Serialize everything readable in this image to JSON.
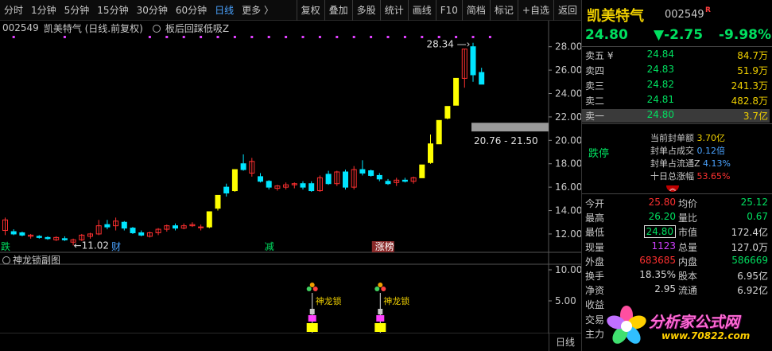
{
  "toolbar": {
    "items": [
      "分时",
      "1分钟",
      "5分钟",
      "15分钟",
      "30分钟",
      "60分钟",
      "日线",
      "更多 〉",
      "复权",
      "叠加",
      "多股",
      "统计",
      "画线",
      "F10",
      "简档",
      "标记",
      "+自选",
      "返回"
    ],
    "active": "日线"
  },
  "chart_header": {
    "code": "002549",
    "name": "凯美特气 (日线.前复权)",
    "indicator": "板后回踩低吸Z"
  },
  "sub_chart": {
    "title": "神龙锁副图",
    "label": "神龙锁",
    "ticks": [
      "10.00",
      "5.00"
    ]
  },
  "chart_data": {
    "type": "candlestick",
    "title": "",
    "xlabel": "",
    "ylabel": "",
    "ylim": [
      10.5,
      29.0
    ],
    "y_ticks": [
      12.0,
      14.0,
      16.0,
      18.0,
      20.0,
      22.0,
      24.0,
      26.0,
      28.0
    ],
    "annotations": {
      "high_label": "28.34",
      "low_label": "11.02",
      "range_label": "20.76 - 21.50",
      "range_band": [
        20.76,
        21.5
      ]
    },
    "event_tags": [
      {
        "text": "跌",
        "index": 0,
        "color": "#00e060"
      },
      {
        "text": "财",
        "index": 13,
        "color": "#4aa3ff"
      },
      {
        "text": "减",
        "index": 31,
        "color": "#00e060"
      },
      {
        "text": "涨榜",
        "index": 44,
        "color": "#ffffff"
      }
    ],
    "x_labels": [
      {
        "text": "2025年",
        "index": 0
      },
      {
        "text": "8",
        "index": 16
      },
      {
        "text": "9",
        "index": 32
      }
    ],
    "candles": [
      {
        "o": 12.3,
        "h": 13.4,
        "l": 11.9,
        "c": 13.2
      },
      {
        "o": 12.2,
        "h": 12.4,
        "l": 11.9,
        "c": 12.0
      },
      {
        "o": 12.1,
        "h": 12.2,
        "l": 11.8,
        "c": 11.9
      },
      {
        "o": 11.8,
        "h": 12.0,
        "l": 11.6,
        "c": 11.9
      },
      {
        "o": 11.8,
        "h": 11.9,
        "l": 11.6,
        "c": 11.7
      },
      {
        "o": 11.7,
        "h": 11.8,
        "l": 11.5,
        "c": 11.6
      },
      {
        "o": 11.5,
        "h": 11.8,
        "l": 11.4,
        "c": 11.7
      },
      {
        "o": 11.6,
        "h": 11.8,
        "l": 11.4,
        "c": 11.5
      },
      {
        "o": 11.3,
        "h": 11.6,
        "l": 11.02,
        "c": 11.5
      },
      {
        "o": 11.5,
        "h": 12.0,
        "l": 11.4,
        "c": 11.9
      },
      {
        "o": 11.8,
        "h": 12.1,
        "l": 11.6,
        "c": 12.0
      },
      {
        "o": 12.0,
        "h": 13.2,
        "l": 11.9,
        "c": 12.7
      },
      {
        "o": 12.8,
        "h": 13.2,
        "l": 12.4,
        "c": 12.6
      },
      {
        "o": 12.7,
        "h": 13.4,
        "l": 12.3,
        "c": 13.1
      },
      {
        "o": 13.0,
        "h": 13.1,
        "l": 12.3,
        "c": 12.5
      },
      {
        "o": 12.5,
        "h": 12.6,
        "l": 12.0,
        "c": 12.1
      },
      {
        "o": 12.1,
        "h": 12.3,
        "l": 11.8,
        "c": 11.9
      },
      {
        "o": 11.8,
        "h": 12.2,
        "l": 11.7,
        "c": 12.1
      },
      {
        "o": 12.1,
        "h": 12.5,
        "l": 11.9,
        "c": 12.4
      },
      {
        "o": 12.4,
        "h": 12.8,
        "l": 12.2,
        "c": 12.7
      },
      {
        "o": 12.7,
        "h": 12.9,
        "l": 12.3,
        "c": 12.5
      },
      {
        "o": 12.5,
        "h": 12.9,
        "l": 12.4,
        "c": 12.7
      },
      {
        "o": 12.7,
        "h": 13.0,
        "l": 12.6,
        "c": 12.8
      },
      {
        "o": 12.6,
        "h": 12.8,
        "l": 12.3,
        "c": 12.6
      },
      {
        "o": 12.6,
        "h": 13.9,
        "l": 12.5,
        "c": 13.9
      },
      {
        "o": 14.2,
        "h": 15.3,
        "l": 14.0,
        "c": 15.3
      },
      {
        "o": 16.0,
        "h": 16.3,
        "l": 15.2,
        "c": 15.5
      },
      {
        "o": 15.7,
        "h": 17.5,
        "l": 15.6,
        "c": 17.5
      },
      {
        "o": 18.0,
        "h": 18.8,
        "l": 17.4,
        "c": 17.5
      },
      {
        "o": 17.2,
        "h": 18.5,
        "l": 16.9,
        "c": 18.2
      },
      {
        "o": 16.9,
        "h": 17.2,
        "l": 16.4,
        "c": 16.5
      },
      {
        "o": 16.5,
        "h": 16.6,
        "l": 15.8,
        "c": 16.0
      },
      {
        "o": 15.9,
        "h": 16.2,
        "l": 15.7,
        "c": 16.1
      },
      {
        "o": 16.0,
        "h": 16.4,
        "l": 15.8,
        "c": 16.2
      },
      {
        "o": 16.2,
        "h": 16.4,
        "l": 15.9,
        "c": 16.3
      },
      {
        "o": 16.3,
        "h": 16.5,
        "l": 15.8,
        "c": 16.0
      },
      {
        "o": 16.3,
        "h": 16.5,
        "l": 15.6,
        "c": 15.7
      },
      {
        "o": 15.7,
        "h": 17.0,
        "l": 15.6,
        "c": 16.8
      },
      {
        "o": 17.1,
        "h": 17.4,
        "l": 16.2,
        "c": 16.3
      },
      {
        "o": 16.3,
        "h": 17.4,
        "l": 16.1,
        "c": 17.3
      },
      {
        "o": 17.3,
        "h": 17.5,
        "l": 15.8,
        "c": 16.0
      },
      {
        "o": 16.0,
        "h": 17.8,
        "l": 15.8,
        "c": 17.5
      },
      {
        "o": 17.5,
        "h": 18.3,
        "l": 17.0,
        "c": 17.2
      },
      {
        "o": 17.4,
        "h": 17.5,
        "l": 16.9,
        "c": 17.0
      },
      {
        "o": 17.0,
        "h": 17.2,
        "l": 16.5,
        "c": 16.7
      },
      {
        "o": 16.5,
        "h": 16.7,
        "l": 16.2,
        "c": 16.3
      },
      {
        "o": 16.4,
        "h": 16.8,
        "l": 16.1,
        "c": 16.6
      },
      {
        "o": 16.6,
        "h": 16.8,
        "l": 16.4,
        "c": 16.5
      },
      {
        "o": 16.5,
        "h": 16.9,
        "l": 16.3,
        "c": 16.8
      },
      {
        "o": 16.8,
        "h": 17.9,
        "l": 16.8,
        "c": 17.9
      },
      {
        "o": 18.1,
        "h": 20.5,
        "l": 18.0,
        "c": 19.7
      },
      {
        "o": 19.7,
        "h": 21.7,
        "l": 19.7,
        "c": 21.7
      },
      {
        "o": 21.9,
        "h": 22.9,
        "l": 21.8,
        "c": 22.9
      },
      {
        "o": 23.0,
        "h": 25.3,
        "l": 23.0,
        "c": 25.3
      },
      {
        "o": 25.3,
        "h": 27.8,
        "l": 24.5,
        "c": 27.8
      },
      {
        "o": 28.0,
        "h": 28.34,
        "l": 25.0,
        "c": 25.6
      },
      {
        "o": 25.8,
        "h": 26.2,
        "l": 24.8,
        "c": 24.8
      }
    ],
    "limit_up_days": [
      24,
      25,
      27,
      49,
      50,
      51,
      52,
      53
    ],
    "top_markers": [
      1,
      7,
      17,
      19,
      21,
      23,
      25,
      27,
      29,
      31,
      33,
      35,
      37,
      39,
      41,
      43,
      45,
      47,
      49,
      51,
      53,
      55,
      57
    ],
    "signal_days": [
      36,
      44
    ]
  },
  "quote": {
    "name": "凯美特气",
    "code": "002549",
    "r_tag": "R",
    "price": "24.80",
    "change": "▼-2.75",
    "change_pct": "-9.98%",
    "asks": [
      {
        "label": "卖五 ¥",
        "price": "24.84",
        "vol": "84.7万"
      },
      {
        "label": "卖四",
        "price": "24.83",
        "vol": "51.9万"
      },
      {
        "label": "卖三",
        "price": "24.82",
        "vol": "241.3万"
      },
      {
        "label": "卖二",
        "price": "24.81",
        "vol": "482.8万"
      },
      {
        "label": "卖一",
        "price": "24.80",
        "vol": "3.7亿"
      }
    ],
    "limit": {
      "status": "跌停",
      "lines": [
        {
          "label": "当前封单额",
          "value": "3.70亿"
        },
        {
          "label": "封单占成交",
          "value": "0.12倍"
        },
        {
          "label": "封单占流通Z",
          "value": "4.13%"
        },
        {
          "label": "十日总涨幅",
          "value": "53.65%"
        }
      ],
      "toggle": "︽"
    },
    "stats": [
      {
        "l1": "今开",
        "v1": "25.80",
        "c1": "red",
        "l2": "均价",
        "v2": "25.12",
        "c2": "green"
      },
      {
        "l1": "最高",
        "v1": "26.20",
        "c1": "green",
        "l2": "量比",
        "v2": "0.67",
        "c2": "green"
      },
      {
        "l1": "最低",
        "v1": "24.80",
        "c1": "green",
        "l2": "市值",
        "v2": "172.4亿",
        "c2": "white"
      },
      {
        "l1": "现量",
        "v1": "1123",
        "c1": "purple",
        "l2": "总量",
        "v2": "127.0万",
        "c2": "white"
      },
      {
        "l1": "外盘",
        "v1": "683685",
        "c1": "red",
        "l2": "内盘",
        "v2": "586669",
        "c2": "green"
      },
      {
        "l1": "换手",
        "v1": "18.35%",
        "c1": "white",
        "l2": "股本",
        "v2": "6.95亿",
        "c2": "white"
      },
      {
        "l1": "净资",
        "v1": "2.95",
        "c1": "white",
        "l2": "流通",
        "v2": "6.92亿",
        "c2": "white"
      },
      {
        "l1": "收益",
        "v1": "",
        "c1": "white",
        "l2": "",
        "v2": "",
        "c2": "white"
      },
      {
        "l1": "交易",
        "v1": "",
        "c1": "white",
        "l2": "",
        "v2": "",
        "c2": "white"
      },
      {
        "l1": "主力",
        "v1": "",
        "c1": "white",
        "l2": "",
        "v2": "",
        "c2": "white"
      }
    ]
  },
  "bottom": {
    "day_button": "日线"
  },
  "watermark": {
    "text": "分析家公式网",
    "url": "www.70822.com"
  },
  "colors": {
    "up": "#ff3030",
    "down": "#00e5ff",
    "limit": "#ffff00",
    "accent_green": "#00e060",
    "accent_yellow": "#f0d000"
  }
}
